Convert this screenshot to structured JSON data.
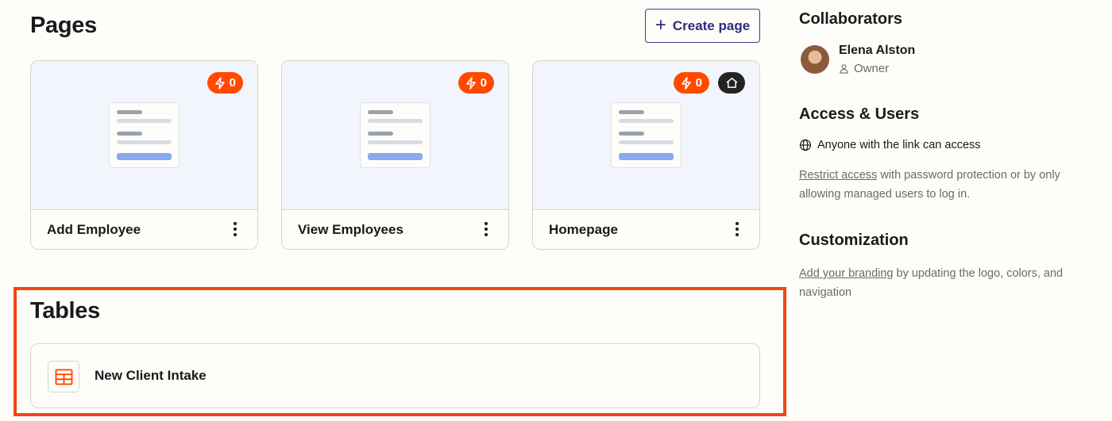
{
  "pages": {
    "title": "Pages",
    "create_label": "Create page",
    "cards": [
      {
        "name": "Add Employee",
        "badge_count": "0",
        "is_home": false
      },
      {
        "name": "View Employees",
        "badge_count": "0",
        "is_home": false
      },
      {
        "name": "Homepage",
        "badge_count": "0",
        "is_home": true
      }
    ]
  },
  "tables": {
    "title": "Tables",
    "items": [
      {
        "name": "New Client Intake"
      }
    ]
  },
  "sidebar": {
    "collaborators_title": "Collaborators",
    "collaborator": {
      "name": "Elena Alston",
      "role": "Owner"
    },
    "access_title": "Access & Users",
    "access_status": "Anyone with the link can access",
    "restrict_link": "Restrict access",
    "restrict_text": " with password protection or by only allowing managed users to log in.",
    "customization_title": "Customization",
    "branding_link": "Add your branding",
    "branding_text": " by updating the logo, colors, and navigation"
  },
  "colors": {
    "accent": "#ff4a00",
    "highlight": "#f2470d",
    "button_text": "#2d2d7f",
    "preview_bg": "#f2f5fb"
  },
  "icons": {
    "badge": "lightning-bolt-icon",
    "home": "home-icon",
    "create": "plus-icon",
    "table": "table-icon",
    "owner": "user-icon",
    "access": "globe-icon",
    "card_menu": "more-vertical-icon"
  }
}
